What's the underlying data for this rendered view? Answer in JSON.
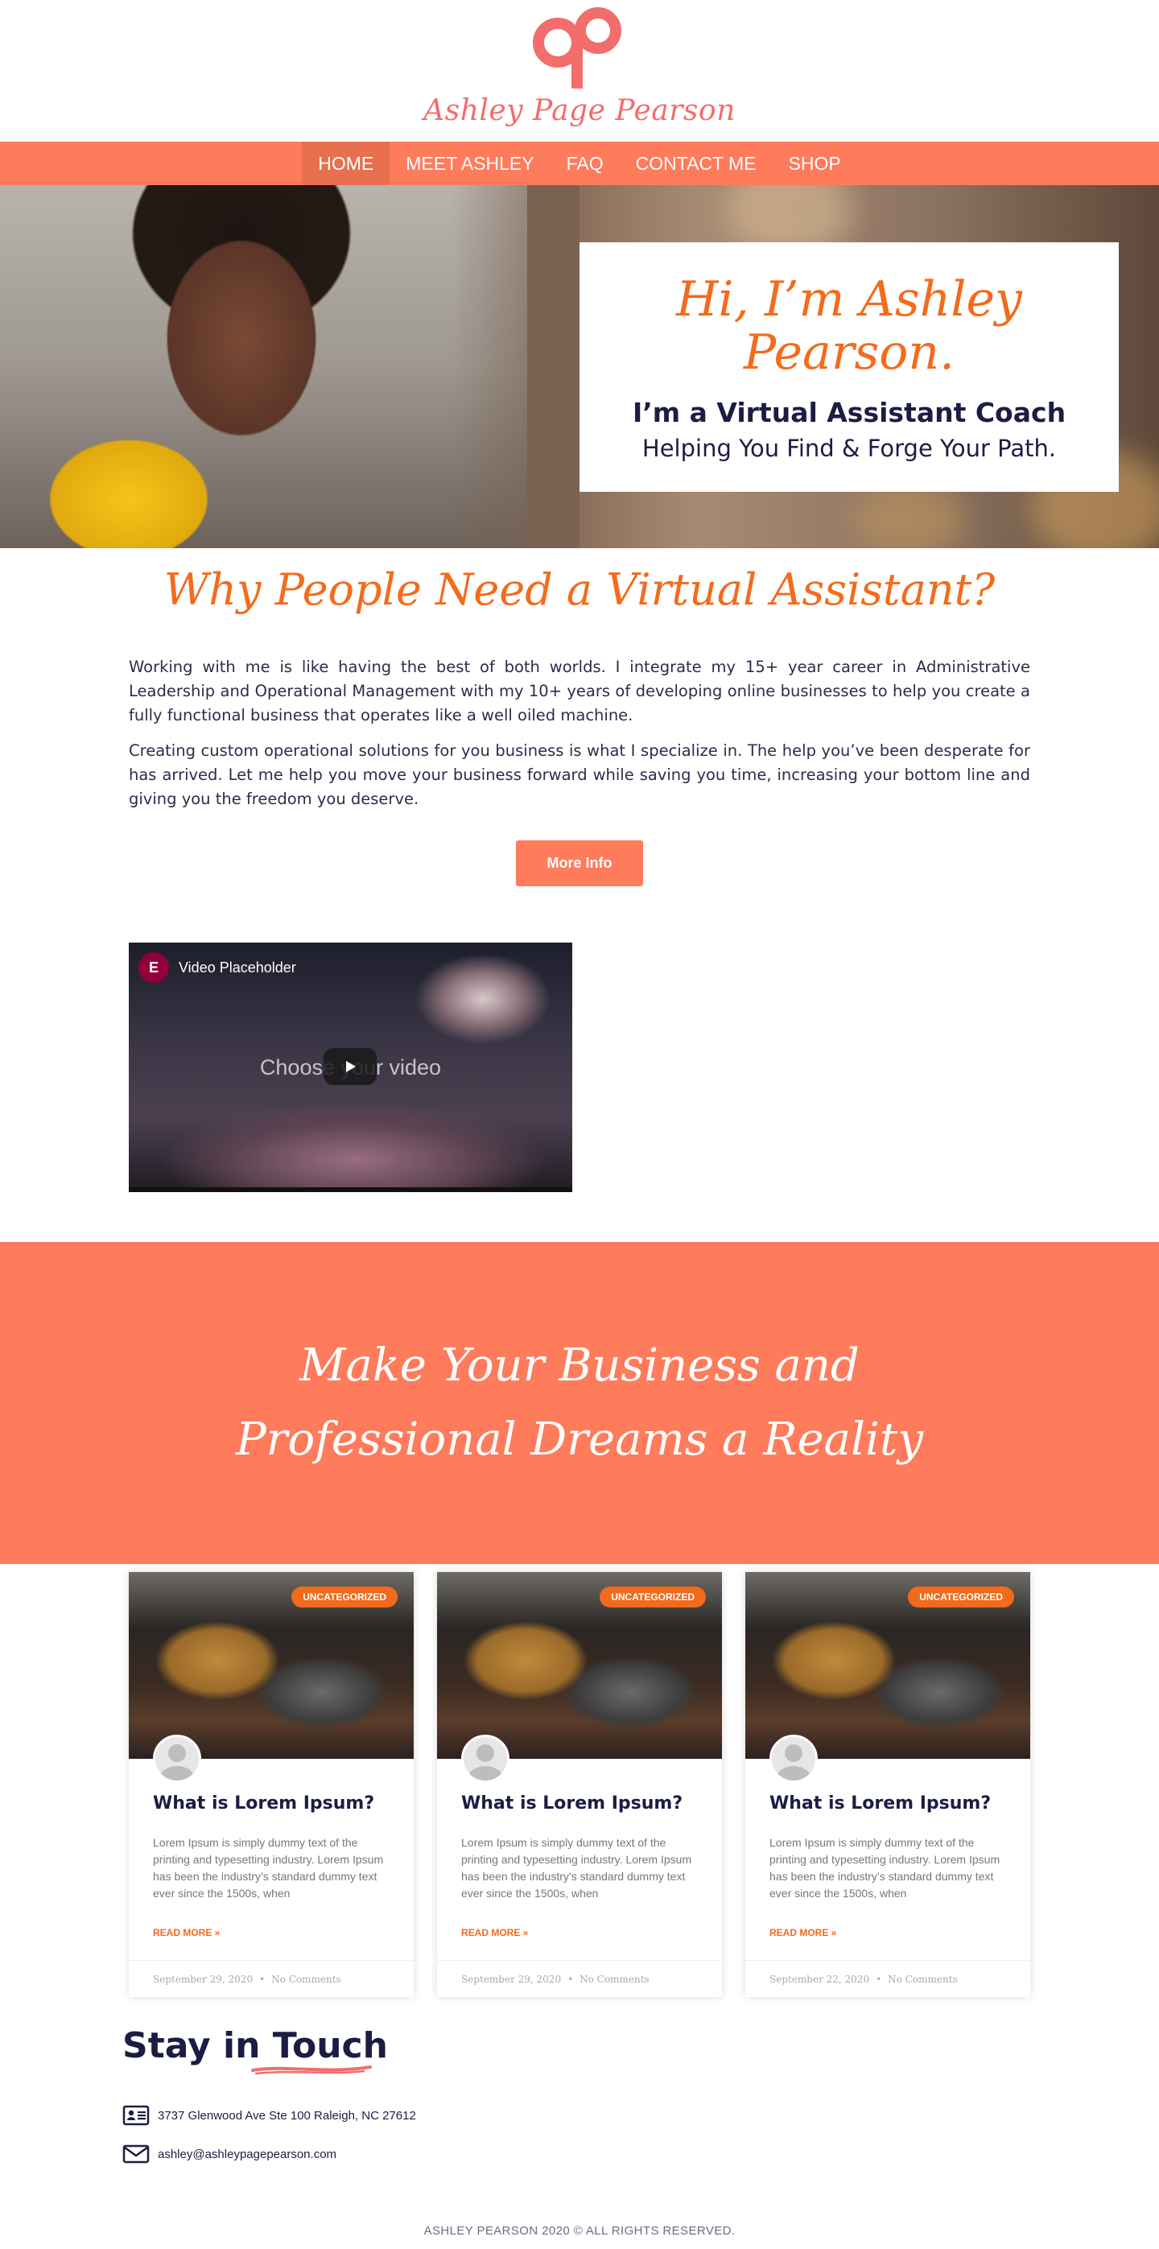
{
  "header": {
    "logo_text": "Ashley Page Pearson",
    "brand_color": "#f26d6b"
  },
  "nav": {
    "items": [
      "HOME",
      "MEET ASHLEY",
      "FAQ",
      "CONTACT ME",
      "SHOP"
    ],
    "active": "HOME",
    "color": "#fe7b5c"
  },
  "hero": {
    "title": "Hi, I’m Ashley Pearson.",
    "subtitle": "I’m a Virtual Assistant Coach",
    "tagline": "Helping You Find & Forge Your Path."
  },
  "why": {
    "title": "Why People Need a Virtual Assistant?",
    "paragraphs": [
      "Working with me is like having the best of both worlds. I integrate my 15+ year career in Administrative Leadership and Operational Management with my 10+ years of developing online businesses to help you create a fully functional business that operates like a well oiled machine.",
      "Creating custom operational solutions for you business is what I specialize in. The help you’ve been desperate for has arrived. Let me help you move your business forward while saving you time, increasing your bottom line and giving you the freedom you deserve."
    ],
    "button": "More Info"
  },
  "video": {
    "label": "Video Placeholder",
    "overlay_text": "Choose your video",
    "logo_glyph": "E"
  },
  "banner": {
    "text": "Make Your Business and Professional Dreams a Reality"
  },
  "posts": [
    {
      "badge": "UNCATEGORIZED",
      "title": "What is Lorem Ipsum?",
      "excerpt": "Lorem Ipsum is simply dummy text of the printing and typesetting industry. Lorem Ipsum has been the industry’s standard dummy text ever since the 1500s, when",
      "read_more": "READ MORE »",
      "date": "September 29, 2020",
      "comments": "No Comments"
    },
    {
      "badge": "UNCATEGORIZED",
      "title": "What is Lorem Ipsum?",
      "excerpt": "Lorem Ipsum is simply dummy text of the printing and typesetting industry. Lorem Ipsum has been the industry’s standard dummy text ever since the 1500s, when",
      "read_more": "READ MORE »",
      "date": "September 29, 2020",
      "comments": "No Comments"
    },
    {
      "badge": "UNCATEGORIZED",
      "title": "What is Lorem Ipsum?",
      "excerpt": "Lorem Ipsum is simply dummy text of the printing and typesetting industry. Lorem Ipsum has been the industry’s standard dummy text ever since the 1500s, when",
      "read_more": "READ MORE »",
      "date": "September 22, 2020",
      "comments": "No Comments"
    }
  ],
  "touch": {
    "title_a": "Stay in ",
    "title_b": "Touch",
    "address": "3737 Glenwood Ave Ste 100 Raleigh, NC 27612",
    "email": "ashley@ashleypagepearson.com"
  },
  "footer": {
    "text": "ASHLEY PEARSON 2020 © ALL RIGHTS RESERVED."
  },
  "colors": {
    "accent": "#fe7b5c",
    "heading_orange": "#f36b1c",
    "navy": "#1b1d44"
  }
}
